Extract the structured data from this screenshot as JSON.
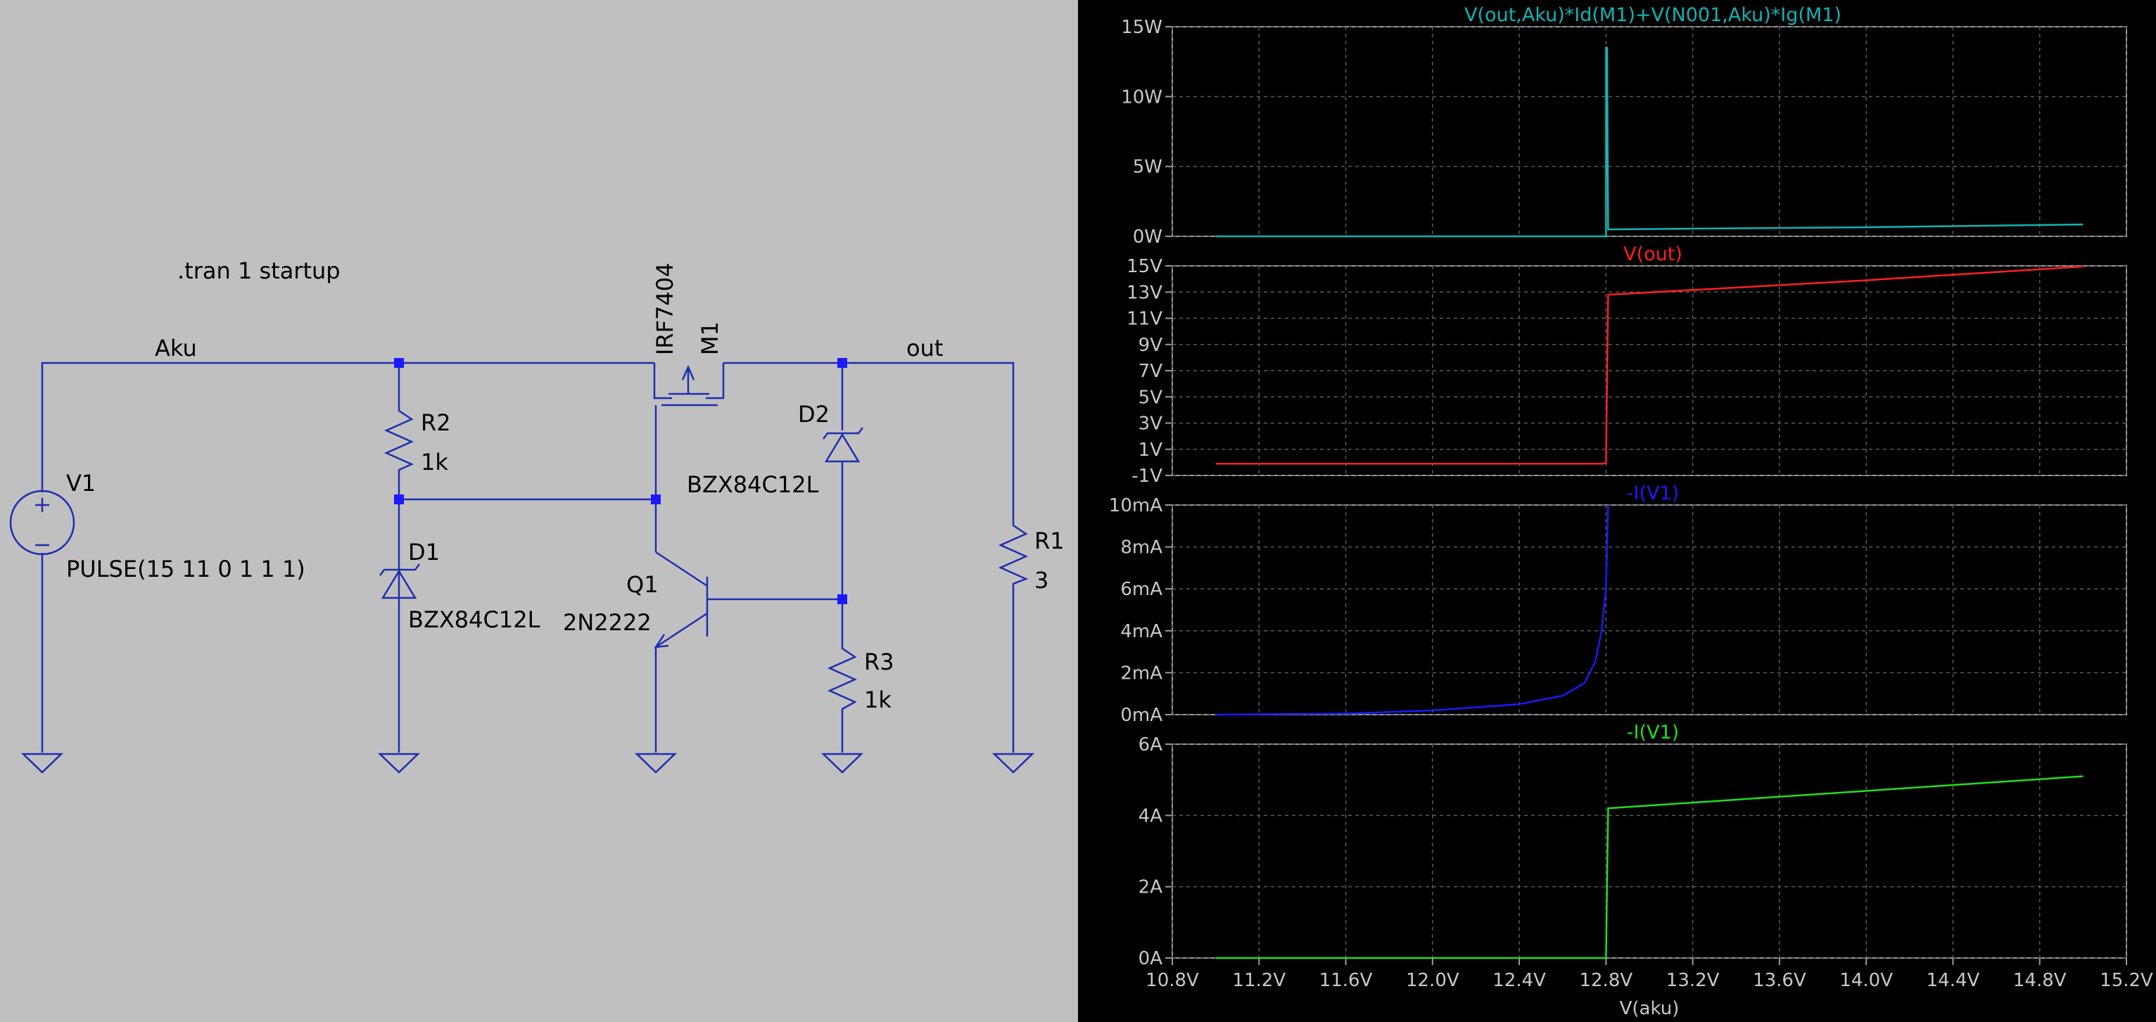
{
  "schematic": {
    "directive": ".tran 1 startup",
    "net_labels": {
      "aku": "Aku",
      "out": "out"
    },
    "components": {
      "v1": {
        "name": "V1",
        "value": "PULSE(15 11 0 1 1 1)"
      },
      "r2": {
        "name": "R2",
        "value": "1k"
      },
      "d1": {
        "name": "D1",
        "value": "BZX84C12L"
      },
      "m1": {
        "name": "M1",
        "value": "IRF7404"
      },
      "d2": {
        "name": "D2",
        "value": "BZX84C12L"
      },
      "q1": {
        "name": "Q1",
        "value": "2N2222"
      },
      "r3": {
        "name": "R3",
        "value": "1k"
      },
      "r1": {
        "name": "R1",
        "value": "3"
      }
    },
    "colors": {
      "wire": "#1d2fb0",
      "node": "#1a1aff",
      "background": "#c0c0c0"
    }
  },
  "chart_data": [
    {
      "type": "line",
      "title": "V(out,Aku)*Id(M1)+V(N001,Aku)*Ig(M1)",
      "color": "#12b3b3",
      "x_tick_labels": [
        "10.8V",
        "11.2V",
        "11.6V",
        "12.0V",
        "12.4V",
        "12.8V",
        "13.2V",
        "13.6V",
        "14.0V",
        "14.4V",
        "14.8V",
        "15.2V"
      ],
      "y_tick_labels": [
        "15W",
        "10W",
        "5W",
        "0W"
      ],
      "xlim": [
        10.8,
        15.2
      ],
      "ylim": [
        0,
        15
      ],
      "x": [
        11.0,
        12.78,
        12.8,
        12.8,
        12.805,
        12.81,
        14.0,
        15.0
      ],
      "y": [
        0.0,
        0.0,
        0.0,
        13.5,
        13.5,
        0.5,
        0.65,
        0.85
      ],
      "grid": true
    },
    {
      "type": "line",
      "title": "V(out)",
      "color": "#ff2020",
      "y_tick_labels": [
        "15V",
        "13V",
        "11V",
        "9V",
        "7V",
        "5V",
        "3V",
        "1V",
        "-1V"
      ],
      "xlim": [
        10.8,
        15.2
      ],
      "ylim": [
        -1,
        15
      ],
      "x": [
        11.0,
        12.79,
        12.8,
        12.81,
        14.0,
        15.0
      ],
      "y": [
        -0.1,
        -0.1,
        0.0,
        12.8,
        13.9,
        14.95
      ],
      "grid": true
    },
    {
      "type": "line",
      "title": "-I(V1)",
      "color": "#1a1aff",
      "y_tick_labels": [
        "10mA",
        "8mA",
        "6mA",
        "4mA",
        "2mA",
        "0mA"
      ],
      "xlim": [
        10.8,
        15.2
      ],
      "ylim": [
        0,
        10
      ],
      "x": [
        11.0,
        11.6,
        12.0,
        12.4,
        12.6,
        12.7,
        12.75,
        12.78,
        12.8,
        12.81
      ],
      "y": [
        0.0,
        0.05,
        0.2,
        0.5,
        0.9,
        1.5,
        2.5,
        4.0,
        6.0,
        10.0
      ],
      "grid": true
    },
    {
      "type": "line",
      "title": "-I(V1)",
      "color": "#22dd22",
      "x_tick_labels": [
        "10.8V",
        "11.2V",
        "11.6V",
        "12.0V",
        "12.4V",
        "12.8V",
        "13.2V",
        "13.6V",
        "14.0V",
        "14.4V",
        "14.8V",
        "15.2V"
      ],
      "xlabel": "V(aku)",
      "y_tick_labels": [
        "6A",
        "4A",
        "2A",
        "0A"
      ],
      "xlim": [
        10.8,
        15.2
      ],
      "ylim": [
        0,
        6
      ],
      "x": [
        11.0,
        12.8,
        12.81,
        15.0
      ],
      "y": [
        0.0,
        0.0,
        4.2,
        5.1
      ],
      "grid": true
    }
  ]
}
